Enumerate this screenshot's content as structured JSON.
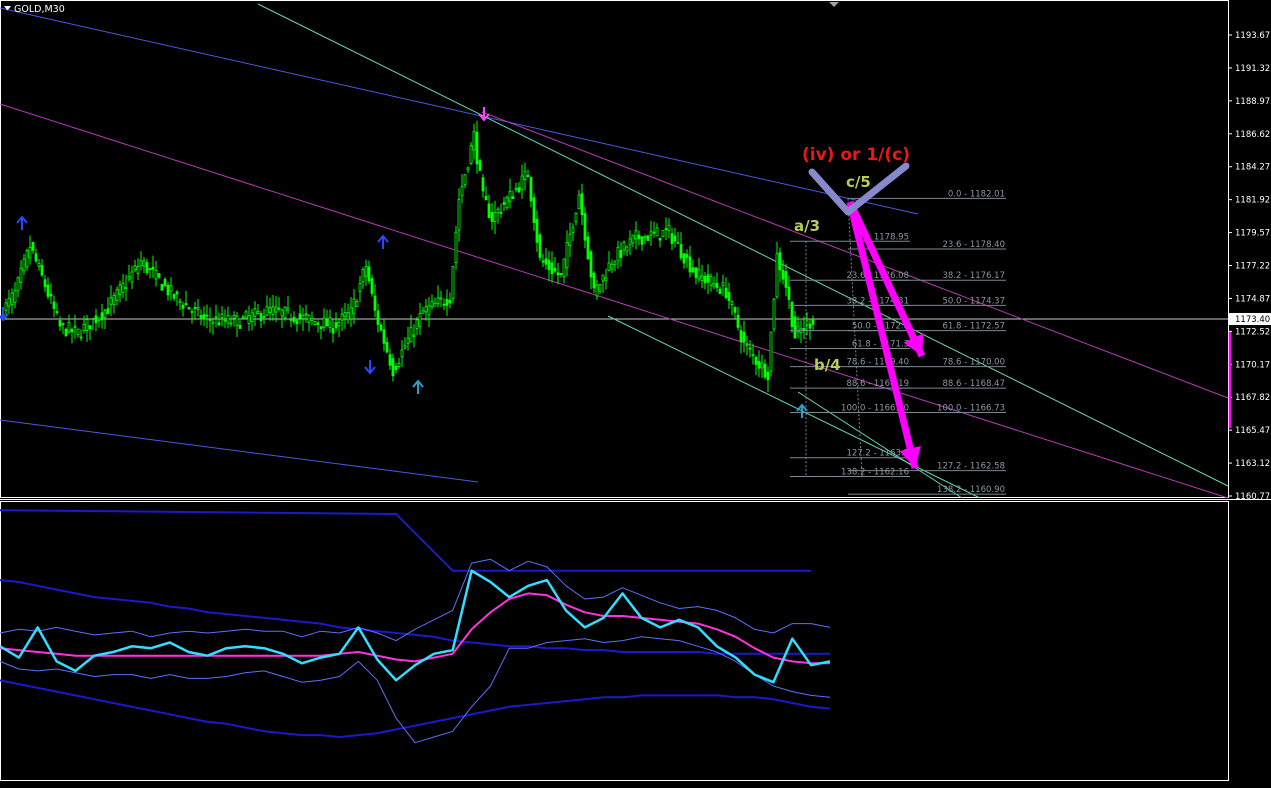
{
  "symbol_label": "GOLD,M30",
  "colors": {
    "background": "#000000",
    "grid_frame": "#ffffff",
    "candle": "#00ff00",
    "channel_blue": "#4a5ae0",
    "channel_magenta": "#b43cb4",
    "channel_teal": "#66d8b0",
    "fib_line": "#7a8894",
    "fib_text": "#8c97a1",
    "arrow": "#ff00ff",
    "label_red": "#e81818",
    "label_green": "#b8cc55",
    "marker_blue": "#2a48ff",
    "marker_teal": "#2aa0c8",
    "marker_magenta": "#ff44ff",
    "osc_cyan": "#33ddff",
    "osc_magenta": "#ff33dd",
    "osc_band_dark": "#1a1acc",
    "osc_band_light": "#5a70ff",
    "wedge": "#8888cc"
  },
  "annotations": {
    "wave_alt": "(iv) or 1/(c)",
    "wave_c5": "c/5",
    "wave_a3": "a/3",
    "wave_b4": "b/4"
  },
  "fib_right": [
    {
      "text": "0.0 - 1182.01",
      "price": 1182.01
    },
    {
      "text": "23.6 - 1178.40",
      "price": 1178.4
    },
    {
      "text": "38.2 - 1176.17",
      "price": 1176.17
    },
    {
      "text": "50.0 - 1174.37",
      "price": 1174.37
    },
    {
      "text": "61.8 - 1172.57",
      "price": 1172.57
    },
    {
      "text": "78.6 - 1170.00",
      "price": 1170.0
    },
    {
      "text": "88.6 - 1168.47",
      "price": 1168.47
    },
    {
      "text": "100.0 - 1166.73",
      "price": 1166.73
    },
    {
      "text": "127.2 - 1162.58",
      "price": 1162.58
    },
    {
      "text": "138.2 - 1160.90",
      "price": 1160.9
    }
  ],
  "fib_left": [
    {
      "text": "1178.95",
      "price": 1178.95
    },
    {
      "text": "23.6 - 1176.08",
      "price": 1176.17
    },
    {
      "text": "38.2 - 1174.31",
      "price": 1174.37
    },
    {
      "text": "50.0 - 1172.8",
      "price": 1172.57
    },
    {
      "text": "61.8 - 1171.3",
      "price": 1171.3
    },
    {
      "text": "78.6 - 1169.40",
      "price": 1170.0
    },
    {
      "text": "88.6 - 1168.19",
      "price": 1168.47
    },
    {
      "text": "100.0 - 1166.80",
      "price": 1166.73
    },
    {
      "text": "127.2 - 1163.5",
      "price": 1163.5
    },
    {
      "text": "138.2 - 1162.16",
      "price": 1162.16
    }
  ],
  "chart_data": {
    "type": "candlestick",
    "title": "GOLD,M30",
    "ylim": [
      1160.77,
      1193.67
    ],
    "price_ticks": [
      {
        "label": "1193.67",
        "value": 1193.67
      },
      {
        "label": "1191.32",
        "value": 1191.32
      },
      {
        "label": "1188.97",
        "value": 1188.97
      },
      {
        "label": "1186.62",
        "value": 1186.62
      },
      {
        "label": "1184.27",
        "value": 1184.27
      },
      {
        "label": "1181.92",
        "value": 1181.92
      },
      {
        "label": "1179.57",
        "value": 1179.57
      },
      {
        "label": "1177.22",
        "value": 1177.22
      },
      {
        "label": "1174.87",
        "value": 1174.87
      },
      {
        "label": "1172.52",
        "value": 1172.52
      },
      {
        "label": "1170.17",
        "value": 1170.17
      },
      {
        "label": "1167.82",
        "value": 1167.82
      },
      {
        "label": "1165.47",
        "value": 1165.47
      },
      {
        "label": "1163.12",
        "value": 1163.12
      },
      {
        "label": "1160.77",
        "value": 1160.77
      }
    ],
    "current_price": {
      "label": "1173.40",
      "value": 1173.4
    },
    "close_anchors": [
      {
        "bar": 0,
        "price": 1174.0
      },
      {
        "bar": 4,
        "price": 1175.2
      },
      {
        "bar": 9,
        "price": 1178.6
      },
      {
        "bar": 14,
        "price": 1175.8
      },
      {
        "bar": 19,
        "price": 1172.8
      },
      {
        "bar": 25,
        "price": 1172.4
      },
      {
        "bar": 35,
        "price": 1174.2
      },
      {
        "bar": 46,
        "price": 1177.5
      },
      {
        "bar": 57,
        "price": 1175.0
      },
      {
        "bar": 67,
        "price": 1173.4
      },
      {
        "bar": 78,
        "price": 1173.2
      },
      {
        "bar": 89,
        "price": 1174.0
      },
      {
        "bar": 99,
        "price": 1173.5
      },
      {
        "bar": 110,
        "price": 1172.9
      },
      {
        "bar": 116,
        "price": 1173.8
      },
      {
        "bar": 121,
        "price": 1177.2
      },
      {
        "bar": 124,
        "price": 1173.9
      },
      {
        "bar": 130,
        "price": 1169.8
      },
      {
        "bar": 134,
        "price": 1171.5
      },
      {
        "bar": 140,
        "price": 1173.9
      },
      {
        "bar": 149,
        "price": 1175.0
      },
      {
        "bar": 152,
        "price": 1182.0
      },
      {
        "bar": 157,
        "price": 1186.5
      },
      {
        "bar": 160,
        "price": 1182.0
      },
      {
        "bar": 163,
        "price": 1180.6
      },
      {
        "bar": 170,
        "price": 1182.4
      },
      {
        "bar": 175,
        "price": 1183.8
      },
      {
        "bar": 179,
        "price": 1177.6
      },
      {
        "bar": 186,
        "price": 1176.4
      },
      {
        "bar": 192,
        "price": 1182.4
      },
      {
        "bar": 197,
        "price": 1175.2
      },
      {
        "bar": 203,
        "price": 1177.6
      },
      {
        "bar": 211,
        "price": 1179.2
      },
      {
        "bar": 222,
        "price": 1179.6
      },
      {
        "bar": 231,
        "price": 1176.6
      },
      {
        "bar": 241,
        "price": 1175.4
      },
      {
        "bar": 247,
        "price": 1171.6
      },
      {
        "bar": 252,
        "price": 1170.2
      },
      {
        "bar": 255,
        "price": 1169.6
      },
      {
        "bar": 258,
        "price": 1177.9
      },
      {
        "bar": 261,
        "price": 1175.8
      },
      {
        "bar": 264,
        "price": 1172.2
      },
      {
        "bar": 270,
        "price": 1173.4
      }
    ],
    "oscillator": {
      "ylim": [
        0,
        100
      ],
      "main_line": [
        48,
        42,
        58,
        40,
        35,
        43,
        45,
        48,
        47,
        50,
        45,
        43,
        47,
        48,
        47,
        44,
        39,
        42,
        44,
        58,
        41,
        30,
        38,
        44,
        46,
        88,
        82,
        74,
        80,
        83,
        67,
        58,
        63,
        76,
        63,
        58,
        62,
        58,
        48,
        42,
        33,
        29,
        52,
        38,
        40
      ],
      "signal_line": [
        47,
        46,
        45,
        44,
        43,
        43,
        43,
        43,
        43,
        43,
        43,
        43,
        43,
        43,
        43,
        43,
        43,
        43,
        44,
        45,
        43,
        41,
        40,
        42,
        44,
        57,
        66,
        73,
        76,
        75,
        70,
        66,
        64,
        64,
        63,
        62,
        61,
        60,
        57,
        53,
        47,
        42,
        40,
        39,
        39
      ],
      "band_upper": [
        55,
        57,
        56,
        58,
        56,
        54,
        55,
        56,
        53,
        55,
        56,
        55,
        56,
        57,
        56,
        56,
        53,
        56,
        55,
        58,
        55,
        51,
        57,
        62,
        67,
        92,
        94,
        88,
        93,
        90,
        80,
        73,
        74,
        79,
        75,
        71,
        68,
        69,
        67,
        63,
        57,
        55,
        60,
        60,
        58
      ],
      "band_lower": [
        40,
        36,
        35,
        36,
        34,
        32,
        33,
        33,
        31,
        33,
        31,
        31,
        32,
        34,
        35,
        32,
        29,
        30,
        32,
        40,
        30,
        10,
        -3,
        0,
        3,
        16,
        27,
        47,
        47,
        50,
        51,
        52,
        50,
        51,
        53,
        52,
        51,
        48,
        45,
        40,
        33,
        27,
        24,
        22,
        21
      ],
      "envelope_upper": [
        83,
        82,
        80,
        78,
        76,
        74,
        73,
        72,
        71,
        69,
        68,
        66,
        65,
        64,
        63,
        62,
        61,
        60,
        58,
        57,
        56,
        55,
        54,
        53,
        51,
        50,
        49,
        48,
        48,
        47,
        47,
        46,
        46,
        45,
        45,
        45,
        45,
        45,
        44,
        44,
        44,
        44,
        44,
        44,
        44
      ],
      "envelope_lower": [
        30,
        28,
        26,
        24,
        22,
        20,
        18,
        16,
        14,
        12,
        10,
        8,
        7,
        5,
        3,
        2,
        1,
        1,
        0,
        1,
        2,
        4,
        6,
        8,
        10,
        12,
        14,
        16,
        17,
        18,
        19,
        20,
        21,
        21,
        22,
        22,
        22,
        22,
        22,
        21,
        21,
        20,
        18,
        16,
        15
      ],
      "envelope_steep": [
        {
          "i": 0,
          "v": 120
        },
        {
          "i": 21,
          "v": 118
        },
        {
          "i": 24,
          "v": 88
        },
        {
          "i": 43,
          "v": 88
        }
      ]
    }
  }
}
